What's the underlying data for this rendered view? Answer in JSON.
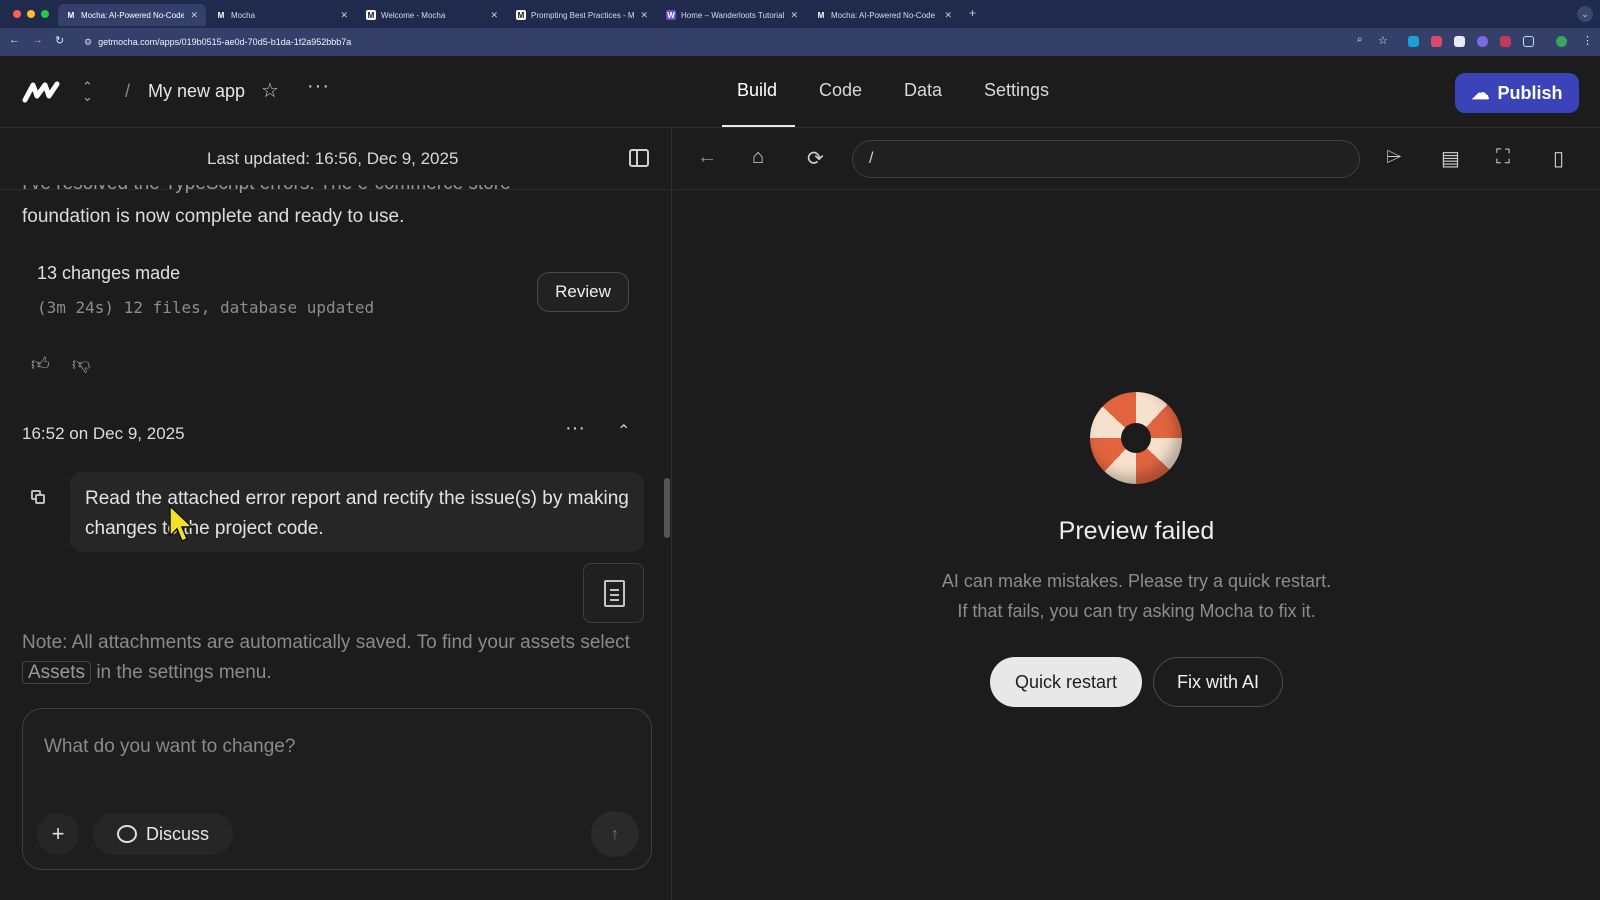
{
  "browser": {
    "tabs": [
      {
        "title": "Mocha: AI-Powered No-Code",
        "active": true
      },
      {
        "title": "Mocha",
        "active": false
      },
      {
        "title": "Welcome - Mocha",
        "active": false
      },
      {
        "title": "Prompting Best Practices - M",
        "active": false
      },
      {
        "title": "Home – Wanderloots Tutorial",
        "active": false
      },
      {
        "title": "Mocha: AI-Powered No-Code",
        "active": false
      }
    ],
    "new_tab": "+",
    "url": "getmocha.com/apps/019b0515-ae0d-70d5-b1da-1f2a952bbb7a"
  },
  "header": {
    "app_name": "My new app",
    "nav_tabs": [
      "Build",
      "Code",
      "Data",
      "Settings"
    ],
    "active_tab": "Build",
    "publish_label": "Publish"
  },
  "left": {
    "last_updated": "Last updated: 16:56, Dec 9, 2025",
    "cut_text": "I've resolved the TypeScript errors. The e-commerce store",
    "message_line": "foundation is now complete and ready to use.",
    "changes_title": "13 changes made",
    "changes_sub": "(3m 24s) 12 files, database updated",
    "review_label": "Review",
    "timestamp": "16:52 on Dec 9, 2025",
    "prompt": "Read the attached error report and rectify the issue(s) by making changes to the project code.",
    "note_prefix": "Note: All attachments are automatically saved. To find your assets select",
    "note_chip": "Assets",
    "note_suffix": "in the settings menu.",
    "composer_placeholder": "What do you want to change?",
    "discuss_label": "Discuss"
  },
  "preview": {
    "path": "/",
    "title": "Preview failed",
    "line1": "AI can make mistakes. Please try a quick restart.",
    "line2": "If that fails, you can try asking Mocha to fix it.",
    "quick_restart": "Quick restart",
    "fix_with_ai": "Fix with AI"
  },
  "colors": {
    "browser_tabbar": "#1f2a4d",
    "browser_toolbar": "#34406a",
    "app_bg": "#1c1c1c",
    "publish_bg": "#3b43b8",
    "buoy_red": "#e2643f",
    "buoy_cream": "#f6e1cc"
  },
  "icons": [
    "mocha-logo-icon",
    "updown-chevron-icon",
    "star-icon",
    "more-dots-icon",
    "cloud-upload-icon",
    "panel-toggle-icon",
    "thumbs-up-icon",
    "thumbs-down-icon",
    "chevron-up-icon",
    "copy-icon",
    "document-icon",
    "plus-icon",
    "chat-bubble-icon",
    "arrow-up-icon",
    "back-arrow-icon",
    "home-icon",
    "refresh-icon",
    "cursor-select-icon",
    "layout-icon",
    "fullscreen-icon",
    "mobile-icon",
    "life-buoy-icon"
  ]
}
